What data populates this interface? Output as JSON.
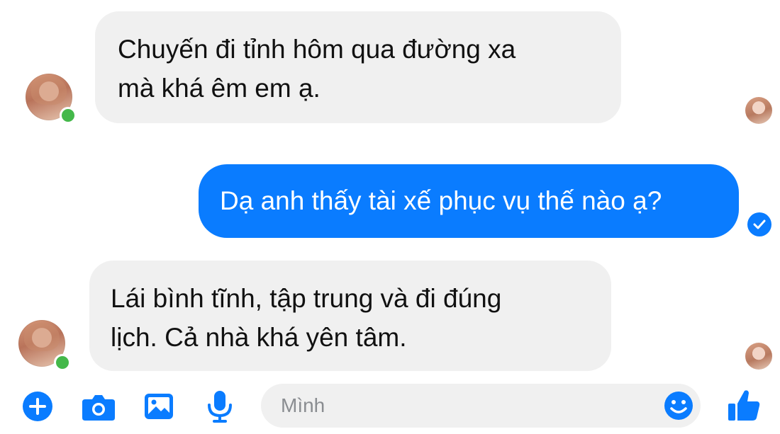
{
  "conversation": {
    "messages": [
      {
        "sender": "contact",
        "lines": [
          "Chuyến đi tỉnh hôm qua đường xa",
          "mà khá êm em ạ."
        ]
      },
      {
        "sender": "me",
        "lines": [
          "Dạ anh thấy tài xế phục vụ thế nào ạ?"
        ]
      },
      {
        "sender": "contact",
        "lines": [
          "Lái bình tĩnh, tập trung và đi đúng",
          "lịch. Cả nhà khá yên tâm."
        ]
      }
    ]
  },
  "composer": {
    "placeholder": "Mình",
    "icons": [
      "plus-icon",
      "camera-icon",
      "image-icon",
      "microphone-icon",
      "emoji-icon",
      "like-icon"
    ]
  },
  "colors": {
    "accent": "#0a7cff",
    "online": "#44b84a",
    "bubble_gray": "#f0f0f0"
  }
}
